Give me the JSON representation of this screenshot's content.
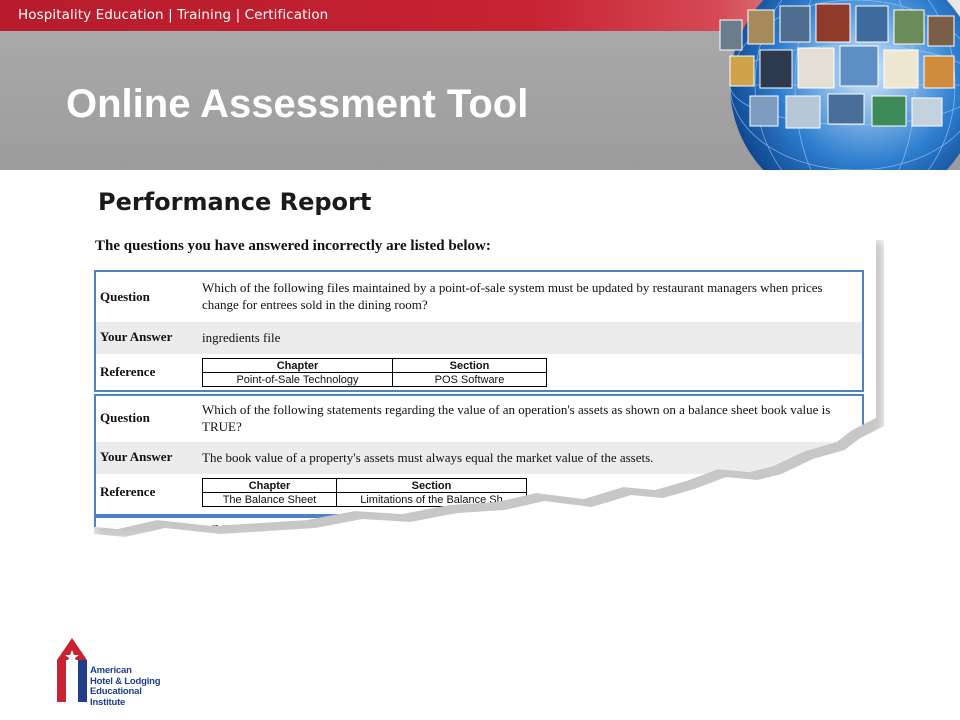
{
  "header": {
    "tagline": "Hospitality Education | Training | Certification",
    "title": "Online Assessment Tool"
  },
  "report": {
    "heading": "Performance Report",
    "intro": "The questions you have answered incorrectly are listed below:",
    "labels": {
      "question": "Question",
      "your_answer": "Your Answer",
      "reference": "Reference"
    },
    "ref_headers": {
      "chapter": "Chapter",
      "section": "Section"
    },
    "questions": [
      {
        "question": "Which of the following files maintained by a point-of-sale system must be updated by restaurant managers when prices change for entrees sold in the dining room?",
        "answer": "ingredients file",
        "chapter": "Point-of-Sale Technology",
        "section": "POS Software"
      },
      {
        "question": "Which of the following statements regarding the value of an operation's assets as shown on a balance sheet book value is TRUE?",
        "answer": "The book value of a property's assets must always equal the market value of the assets.",
        "chapter": "The Balance Sheet",
        "section": "Limitations of the Balance Sh"
      }
    ],
    "partial_next": "Whi"
  },
  "logo": {
    "line1": "American",
    "line2": "Hotel & Lodging",
    "line3": "Educational Institute"
  },
  "colors": {
    "brand_red": "#c62232",
    "header_grey": "#a3a3a3",
    "block_border": "#4c83c2",
    "logo_blue": "#1f3d8a"
  }
}
